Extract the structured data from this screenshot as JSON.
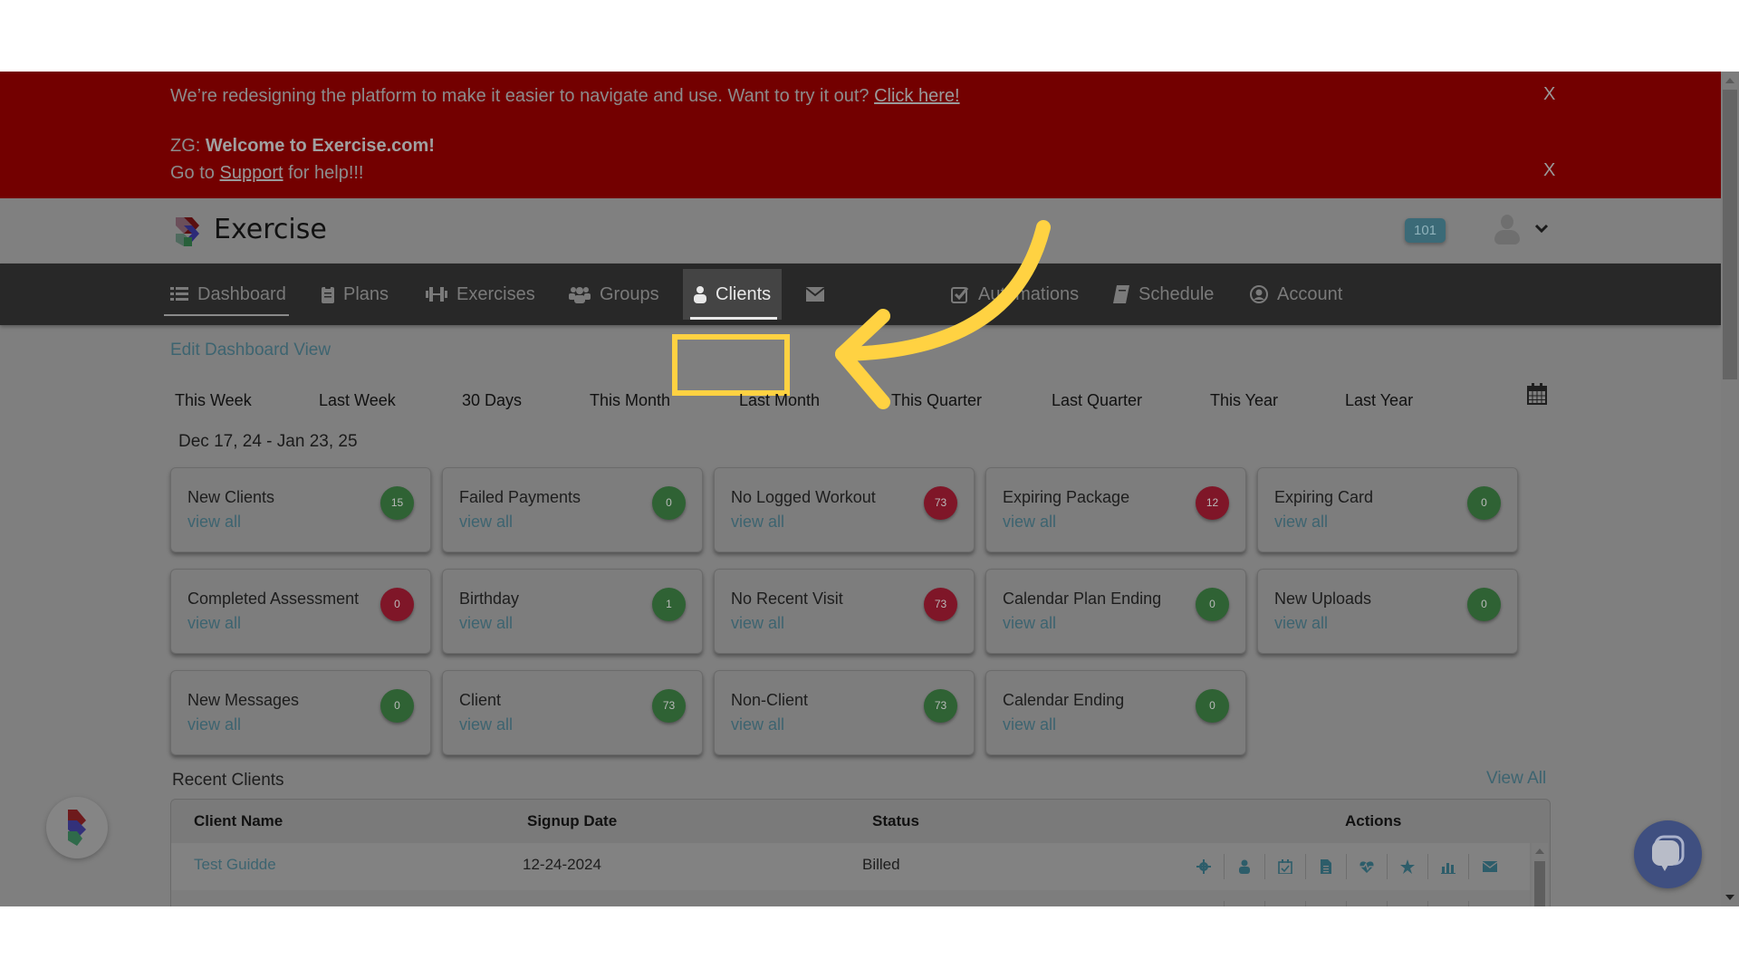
{
  "banner": {
    "redesign_text": "We’re redesigning the platform to make it easier to navigate and use. Want to try it out? ",
    "redesign_link": "Click here!",
    "welcome_prefix": "ZG: ",
    "welcome_bold": "Welcome to Exercise.com!",
    "support_prefix": "Go to ",
    "support_link": "Support",
    "support_suffix": " for help!!!",
    "close_label": "X",
    "color": "#730000"
  },
  "header": {
    "brand": "Exercise",
    "notification_count": "101",
    "avatar_icon": "user-icon",
    "menu_icon": "chevron-down-icon"
  },
  "nav": {
    "items": [
      {
        "label": "Dashboard",
        "icon": "list-icon",
        "active": true
      },
      {
        "label": "Plans",
        "icon": "clipboard-icon"
      },
      {
        "label": "Exercises",
        "icon": "dumbbell-icon"
      },
      {
        "label": "Groups",
        "icon": "users-icon"
      },
      {
        "label": "Clients",
        "icon": "user-icon",
        "highlighted": true
      },
      {
        "label": "",
        "icon": "envelope-icon"
      },
      {
        "label": "Automations",
        "icon": "check-square-icon"
      },
      {
        "label": "Schedule",
        "icon": "book-icon"
      },
      {
        "label": "Account",
        "icon": "user-circle-icon"
      }
    ],
    "highlight_color": "#ffd242"
  },
  "dashboard": {
    "edit_link": "Edit Dashboard View",
    "ranges": [
      "This Week",
      "Last Week",
      "30 Days",
      "This Month",
      "Last Month",
      "This Quarter",
      "Last Quarter",
      "This Year",
      "Last Year"
    ],
    "date_range": "Dec 17, 24 - Jan 23, 25",
    "view_all_label": "view all",
    "cards": [
      {
        "title": "New Clients",
        "count": "15",
        "status": "green"
      },
      {
        "title": "Failed Payments",
        "count": "0",
        "status": "green"
      },
      {
        "title": "No Logged Workout",
        "count": "73",
        "status": "red"
      },
      {
        "title": "Expiring Package",
        "count": "12",
        "status": "red"
      },
      {
        "title": "Expiring Card",
        "count": "0",
        "status": "green"
      },
      {
        "title": "Completed Assessment",
        "count": "0",
        "status": "red"
      },
      {
        "title": "Birthday",
        "count": "1",
        "status": "green"
      },
      {
        "title": "No Recent Visit",
        "count": "73",
        "status": "red"
      },
      {
        "title": "Calendar Plan Ending",
        "count": "0",
        "status": "green"
      },
      {
        "title": "New Uploads",
        "count": "0",
        "status": "green"
      },
      {
        "title": "New Messages",
        "count": "0",
        "status": "green"
      },
      {
        "title": "Client",
        "count": "73",
        "status": "green"
      },
      {
        "title": "Non-Client",
        "count": "73",
        "status": "green"
      },
      {
        "title": "Calendar Ending",
        "count": "0",
        "status": "green"
      }
    ]
  },
  "recent_clients": {
    "title": "Recent Clients",
    "view_all": "View All",
    "columns": [
      "Client Name",
      "Signup Date",
      "Status",
      "Actions"
    ],
    "rows": [
      {
        "name": "Test Guidde",
        "signup_date": "12-24-2024",
        "status": "Billed"
      },
      {
        "name": "",
        "signup_date": "",
        "status": ""
      }
    ],
    "action_icons": [
      "gear-icon",
      "user-icon",
      "calendar-check-icon",
      "file-icon",
      "heartbeat-icon",
      "star-icon",
      "bar-chart-icon",
      "envelope-icon"
    ]
  }
}
